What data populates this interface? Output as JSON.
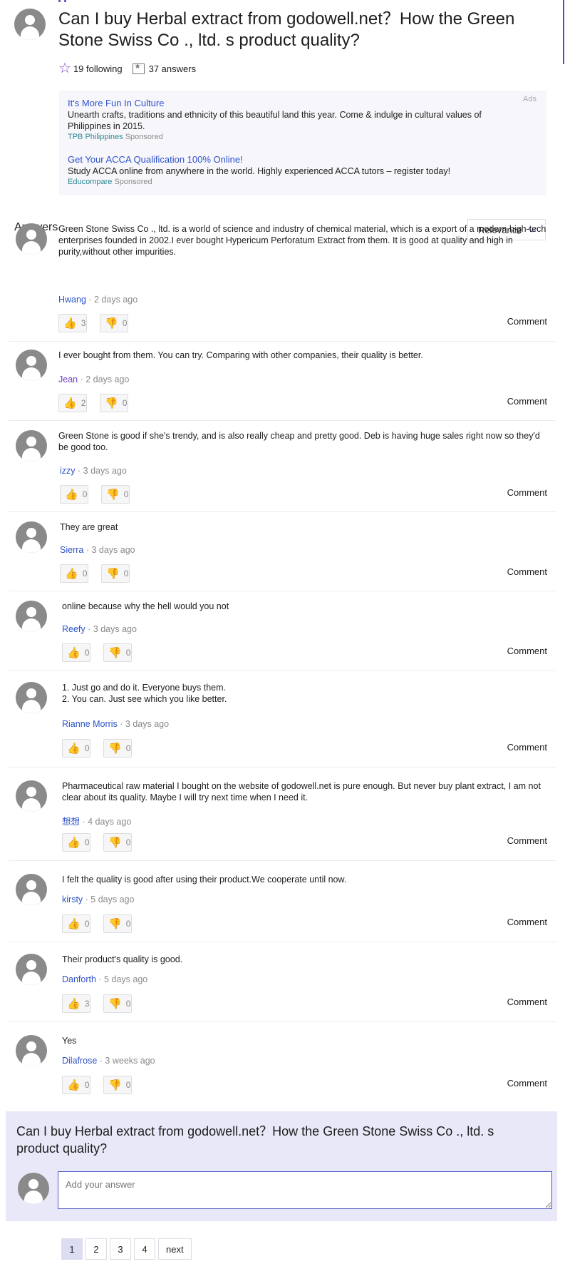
{
  "question": {
    "title": "Can I buy Herbal extract from godowell.net？How the Green Stone Swiss Co ., ltd. s product quality?",
    "following": "19 following",
    "answers_count": "37 answers"
  },
  "ads": {
    "label": "Ads",
    "items": [
      {
        "title": "It's More Fun In Culture",
        "description": "Unearth crafts, traditions and ethnicity of this beautiful land this year. Come & indulge in cultural values of Philippines in 2015.",
        "source": "TPB Philippines",
        "sponsored": "Sponsored"
      },
      {
        "title": "Get Your ACCA Qualification 100% Online!",
        "description": "Study ACCA online from anywhere in the world. Highly experienced ACCA tutors – register today!",
        "source": "Educompare",
        "sponsored": "Sponsored"
      }
    ]
  },
  "answers_section": {
    "heading": "Answers",
    "sort": "Relevance"
  },
  "answers": [
    {
      "text": "Green Stone Swiss Co ., ltd. is a world of science and industry of chemical material, which is a export of a modern high-tech enterprises founded in 2002.I ever bought Hypericum Perforatum Extract from them. It is good at quality and high in purity,without other impurities.",
      "author": "Hwang",
      "time": " · 2 days ago",
      "up": "3",
      "down": "0",
      "comment": "Comment"
    },
    {
      "text": "I ever bought from them. You can try. Comparing with other companies, their quality is better.",
      "author": "Jean",
      "time": " · 2 days ago",
      "up": "2",
      "down": "0",
      "comment": "Comment"
    },
    {
      "text": "Green Stone is good if she's trendy,   and is also really cheap and pretty good. Deb is having huge sales right now so they'd be good too.",
      "author": "izzy",
      "time": " · 3 days ago",
      "up": "0",
      "down": "0",
      "comment": "Comment"
    },
    {
      "text": "They are great",
      "author": "Sierra",
      "time": " · 3 days ago",
      "up": "0",
      "down": "0",
      "comment": "Comment"
    },
    {
      "text": "online because why the hell would you not",
      "author": "Reefy",
      "time": " · 3 days ago",
      "up": "0",
      "down": "0",
      "comment": "Comment"
    },
    {
      "text": "1. Just go and do it. Everyone buys them.\n2. You can. Just see which you like better.",
      "author": "Rianne Morris",
      "time": " · 3 days ago",
      "up": "0",
      "down": "0",
      "comment": "Comment"
    },
    {
      "text": "Pharmaceutical raw material I bought on the website of godowell.net is pure enough. But never buy plant extract, I am not clear about its quality. Maybe I will try next time when I need it.",
      "author": "想想",
      "time": " · 4 days ago",
      "up": "0",
      "down": "0",
      "comment": "Comment"
    },
    {
      "text": "I felt the quality is good after using their product.We cooperate until now.",
      "author": "kirsty",
      "time": " · 5 days ago",
      "up": "0",
      "down": "0",
      "comment": "Comment"
    },
    {
      "text": "Their product's quality is good.",
      "author": "Danforth",
      "time": " · 5 days ago",
      "up": "3",
      "down": "0",
      "comment": "Comment"
    },
    {
      "text": "Yes",
      "author": "Dilafrose",
      "time": " · 3 weeks ago",
      "up": "0",
      "down": "0",
      "comment": "Comment"
    }
  ],
  "add_answer": {
    "question": "Can I buy Herbal extract from godowell.net？How the Green Stone Swiss Co ., ltd. s product quality?",
    "placeholder": "Add your answer"
  },
  "pagination": {
    "pages": [
      "1",
      "2",
      "3",
      "4"
    ],
    "next": "next",
    "current": "1"
  },
  "colors": {
    "accent": "#6e3fc4",
    "link": "#2d53c9",
    "ad_source": "#2a8a92",
    "add_box_bg": "#e8e8f8"
  }
}
